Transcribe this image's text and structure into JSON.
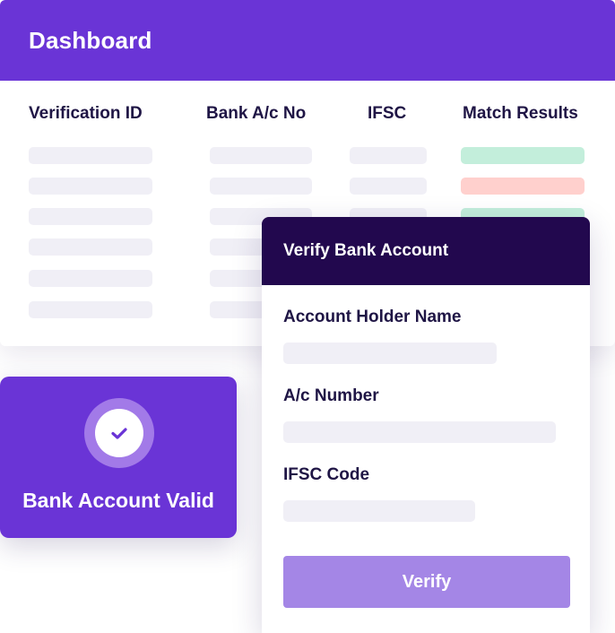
{
  "dashboard": {
    "title": "Dashboard",
    "columns": [
      "Verification ID",
      "Bank A/c No",
      "IFSC",
      "Match Results"
    ],
    "match_results_colors": [
      "#c3eedb",
      "#ffd0cd",
      "#c3eedb"
    ]
  },
  "valid_badge": {
    "text": "Bank Account Valid",
    "icon": "check-icon"
  },
  "verify_form": {
    "title": "Verify Bank Account",
    "fields": [
      {
        "label": "Account Holder Name",
        "value": ""
      },
      {
        "label": "A/c Number",
        "value": ""
      },
      {
        "label": "IFSC Code",
        "value": ""
      }
    ],
    "button_label": "Verify"
  },
  "colors": {
    "accent": "#6a34d6",
    "dark": "#22084e",
    "button": "#a486e6"
  }
}
